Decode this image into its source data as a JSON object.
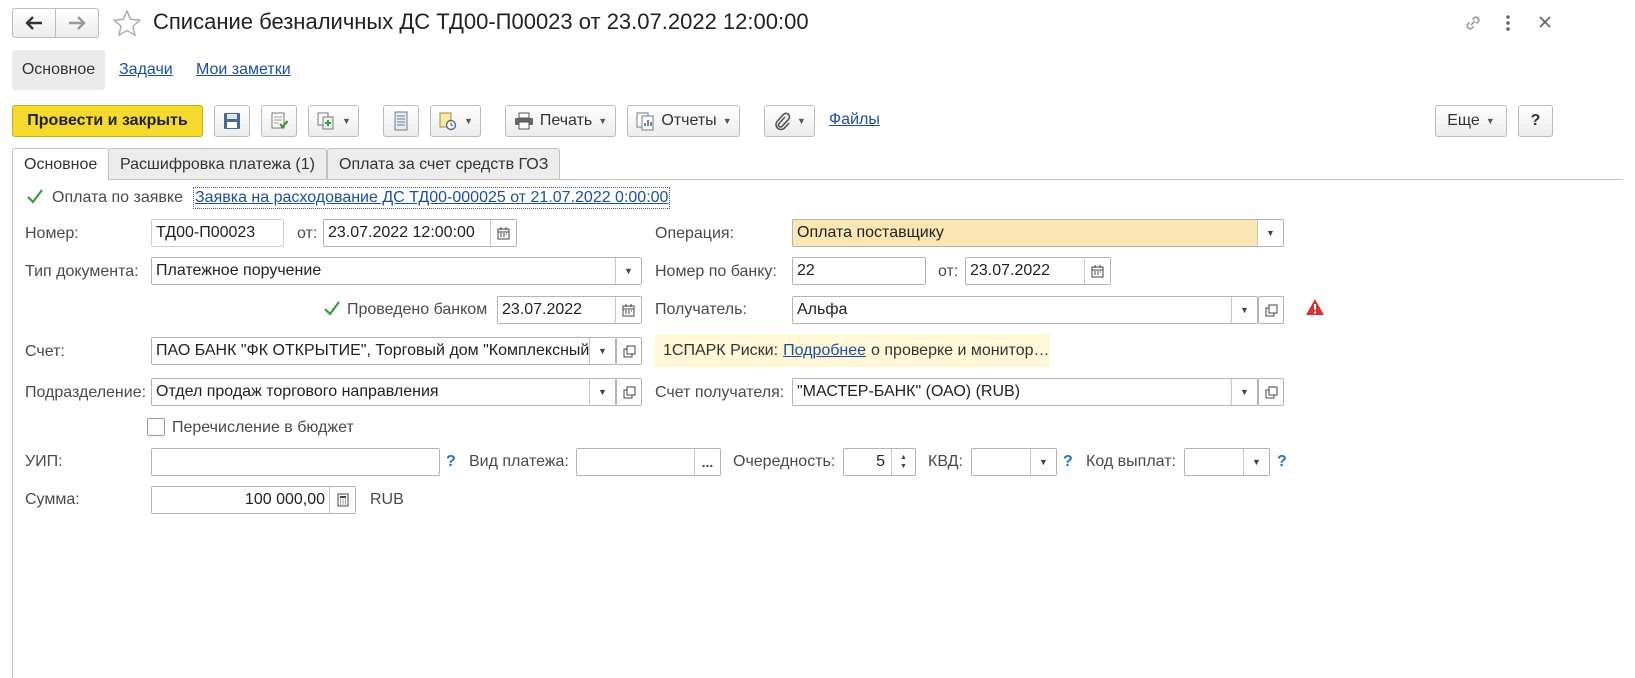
{
  "window": {
    "title": "Списание безналичных ДС ТД00-П00023 от 23.07.2022 12:00:00"
  },
  "nav_tabs": [
    "Основное",
    "Задачи",
    "Мои заметки"
  ],
  "toolbar": {
    "post_close": "Провести и закрыть",
    "print": "Печать",
    "reports": "Отчеты",
    "files": "Файлы",
    "more": "Еще",
    "help": "?"
  },
  "form_tabs": [
    "Основное",
    "Расшифровка платежа (1)",
    "Оплата за счет средств ГОЗ"
  ],
  "form": {
    "pay_by_request_label": "Оплата по заявке",
    "pay_by_request_checked": true,
    "request_link": "Заявка на расходование ДС ТД00-000025 от 21.07.2022 0:00:00",
    "number_label": "Номер:",
    "number_value": "ТД00-П00023",
    "from_label": "от:",
    "date_value": "23.07.2022 12:00:00",
    "doctype_label": "Тип документа:",
    "doctype_value": "Платежное поручение",
    "bank_processed_label": "Проведено банком",
    "bank_processed_checked": true,
    "bank_processed_date": "23.07.2022",
    "account_label": "Счет:",
    "account_value": "ПАО БАНК \"ФК ОТКРЫТИЕ\", Торговый дом \"Комплексный\"",
    "department_label": "Подразделение:",
    "department_value": "Отдел продаж торгового направления",
    "budget_label": "Перечисление в бюджет",
    "budget_checked": false,
    "uip_label": "УИП:",
    "uip_value": "",
    "payment_kind_label": "Вид платежа:",
    "payment_kind_value": "",
    "priority_label": "Очередность:",
    "priority_value": "5",
    "kvd_label": "КВД:",
    "kvd_value": "",
    "payout_code_label": "Код выплат:",
    "payout_code_value": "",
    "amount_label": "Сумма:",
    "amount_value": "100 000,00",
    "currency": "RUB",
    "operation_label": "Операция:",
    "operation_value": "Оплата поставщику",
    "bank_number_label": "Номер по банку:",
    "bank_number_value": "22",
    "bank_from_label": "от:",
    "bank_date_value": "23.07.2022",
    "recipient_label": "Получатель:",
    "recipient_value": "Альфа",
    "spark_prefix": "1СПАРК Риски:",
    "spark_link": "Подробнее",
    "spark_suffix": "о проверке и монитор…",
    "recipient_account_label": "Счет получателя:",
    "recipient_account_value": "\"МАСТЕР-БАНК\" (ОАО) (RUB)",
    "qmark": "?",
    "ellipsis": "..."
  },
  "colors": {
    "primary_button": "#f5d92e",
    "operation_bg": "#fce7b4",
    "spark_bg": "#fff7d6",
    "warning": "#d9322c"
  }
}
